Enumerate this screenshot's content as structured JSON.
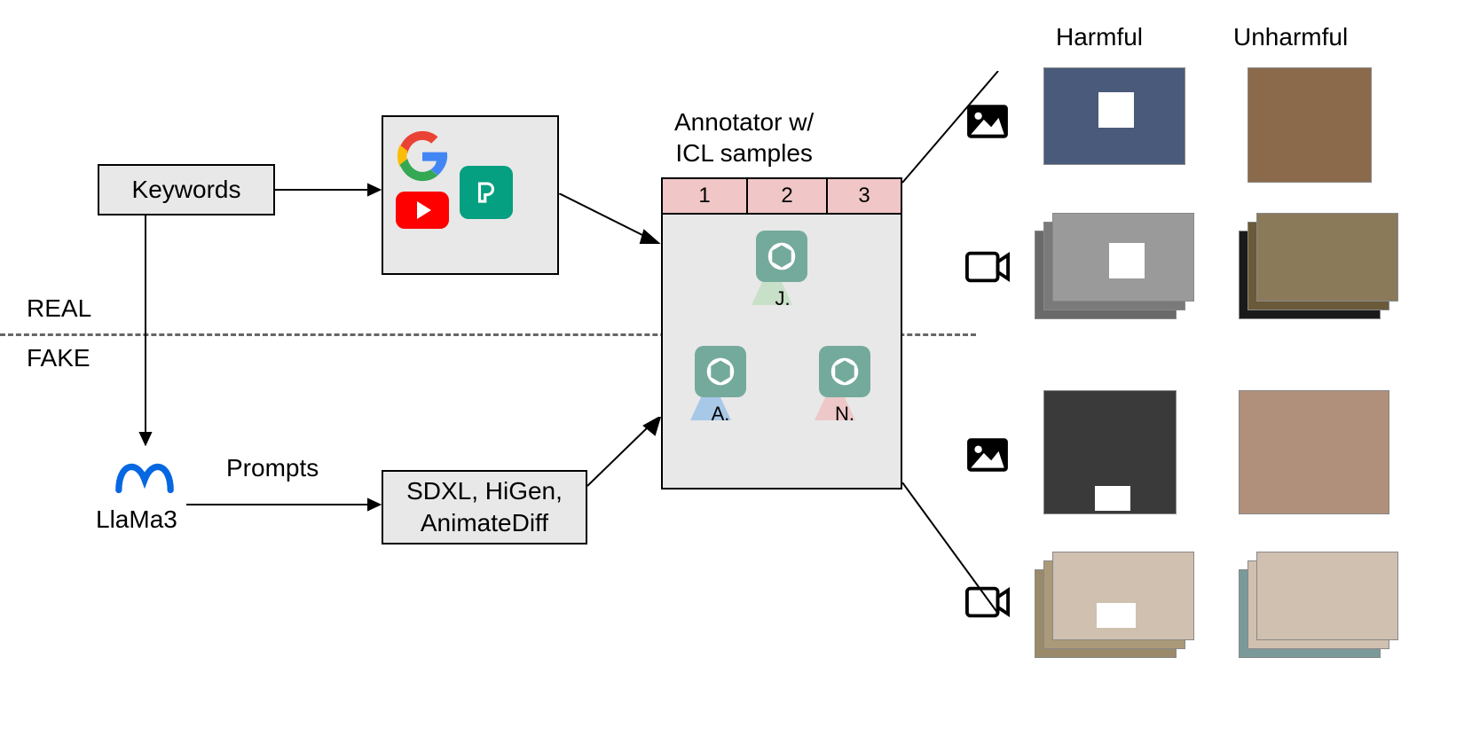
{
  "labels": {
    "keywords": "Keywords",
    "real": "REAL",
    "fake": "FAKE",
    "llama": "LlaMa3",
    "prompts": "Prompts",
    "generators": "SDXL, HiGen,\nAnimateDiff",
    "annotator_title": "Annotator w/\nICL samples",
    "harmful": "Harmful",
    "unharmful": "Unharmful"
  },
  "annotator_headers": [
    "1",
    "2",
    "3"
  ],
  "annotator_names": [
    "J.",
    "A.",
    "N."
  ],
  "icons": {
    "google": "google-icon",
    "youtube": "youtube-icon",
    "pexels": "pexels-icon",
    "meta": "meta-icon",
    "openai": "openai-icon",
    "image": "image-icon",
    "video": "video-icon"
  }
}
